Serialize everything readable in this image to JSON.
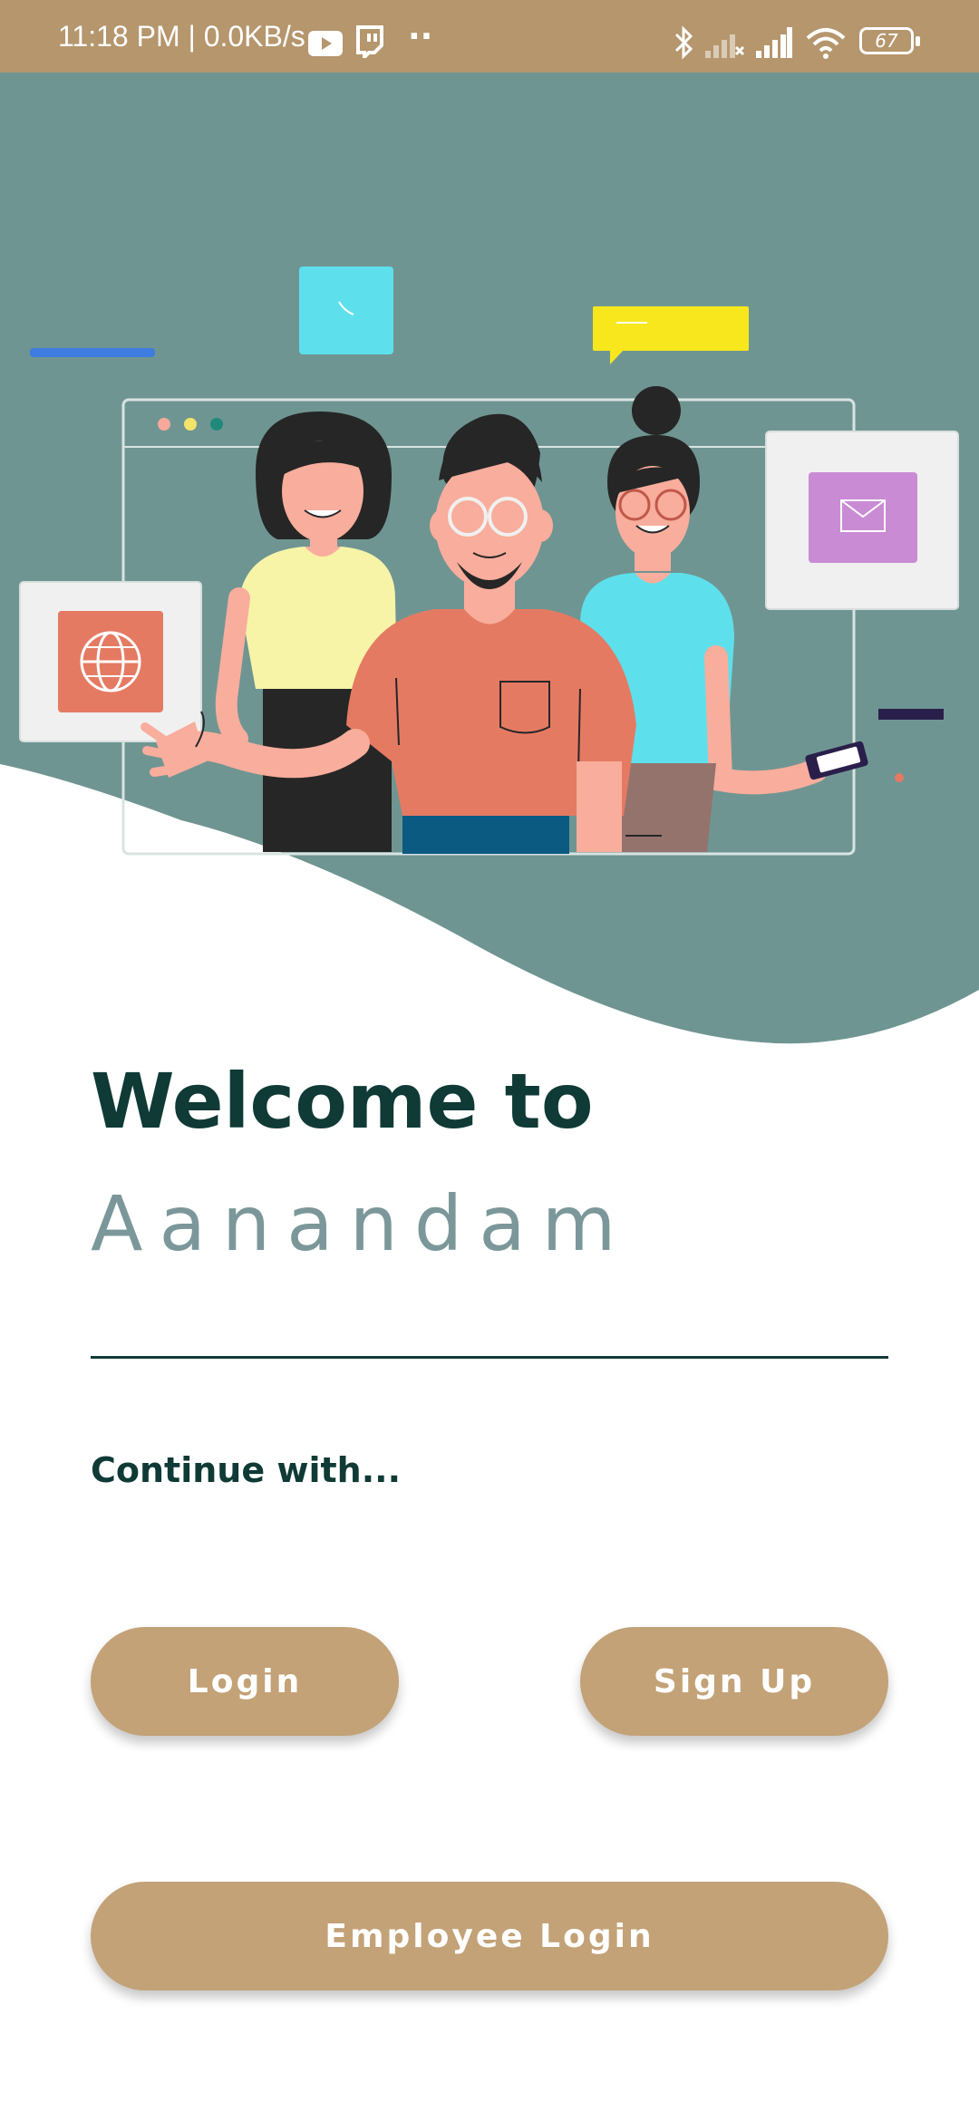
{
  "status_bar": {
    "time_speed": "11:18 PM | 0.0KB/s",
    "more_dots": "··",
    "battery": "67",
    "icons": [
      "youtube-icon",
      "twitch-icon",
      "bluetooth-icon",
      "signal-icon",
      "wifi-icon",
      "battery-icon"
    ]
  },
  "hero": {
    "illustration": "team-waving-illustration",
    "colors": {
      "background": "#6f9592",
      "accent_orange": "#e57a63",
      "accent_yellow": "#f7f4a8",
      "accent_cyan": "#5ee0ec"
    }
  },
  "welcome": {
    "title": "Welcome to",
    "brand": "Aanandam",
    "continue_label": "Continue with..."
  },
  "buttons": {
    "login": "Login",
    "signup": "Sign Up",
    "employee_login": "Employee Login"
  },
  "colors": {
    "status_bar": "#b5966d",
    "button": "#c3a277",
    "title_text": "#0f3a35",
    "brand_text": "#7b979a"
  }
}
